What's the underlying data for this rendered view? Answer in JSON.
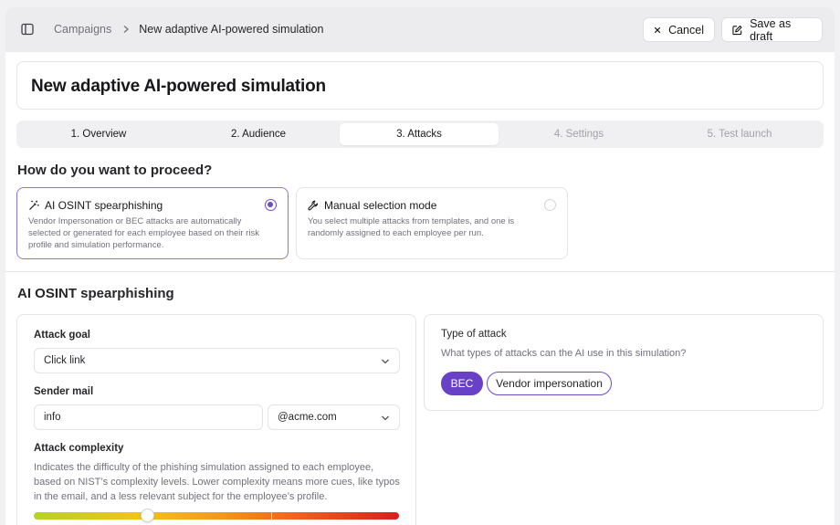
{
  "header": {
    "breadcrumb": {
      "parent": "Campaigns",
      "current": "New adaptive AI-powered simulation"
    },
    "cancel_label": "Cancel",
    "save_draft_label": "Save as draft"
  },
  "campaign": {
    "title": "New adaptive AI-powered simulation"
  },
  "steps": [
    {
      "label": "1. Overview",
      "state": "done"
    },
    {
      "label": "2. Audience",
      "state": "done"
    },
    {
      "label": "3. Attacks",
      "state": "active"
    },
    {
      "label": "4. Settings",
      "state": "disabled"
    },
    {
      "label": "5. Test launch",
      "state": "disabled"
    }
  ],
  "proceed": {
    "question": "How do you want to proceed?",
    "options": [
      {
        "title": "AI OSINT spearphishing",
        "description": "Vendor Impersonation or BEC attacks are automatically selected or generated for each employee based on their risk profile and simulation performance.",
        "selected": true,
        "icon": "magic-wand-icon"
      },
      {
        "title": "Manual selection mode",
        "description": "You select multiple attacks from templates, and one is randomly assigned to each employee per run.",
        "selected": false,
        "icon": "wrench-icon"
      }
    ]
  },
  "osint": {
    "section_title": "AI OSINT spearphishing",
    "attack_goal": {
      "label": "Attack goal",
      "value": "Click link"
    },
    "sender_mail": {
      "label": "Sender mail",
      "local_part": "info",
      "domain": "@acme.com"
    },
    "complexity": {
      "label": "Attack complexity",
      "description": "Indicates the difficulty of the phishing simulation assigned to each employee, based on NIST’s complexity levels. Lower complexity means more cues, like typos in the email, and a less relevant subject for the employee’s profile.",
      "level": 0.31
    },
    "type_of_attack": {
      "label": "Type of attack",
      "question": "What types of attacks can the AI use in this simulation?",
      "options": [
        {
          "label": "BEC",
          "selected": true
        },
        {
          "label": "Vendor impersonation",
          "selected": false
        }
      ]
    }
  },
  "colors": {
    "accent": "#6941c6",
    "accent_border": "#8b76d6",
    "muted_text": "#71717a"
  }
}
